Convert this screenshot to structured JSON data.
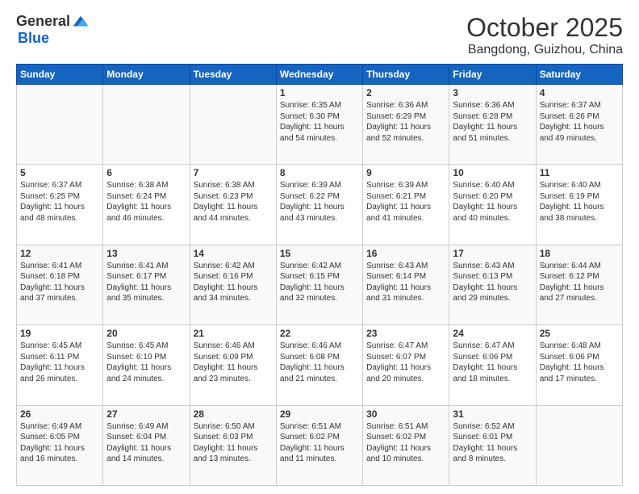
{
  "header": {
    "logo_general": "General",
    "logo_blue": "Blue",
    "month_title": "October 2025",
    "location": "Bangdong, Guizhou, China"
  },
  "weekdays": [
    "Sunday",
    "Monday",
    "Tuesday",
    "Wednesday",
    "Thursday",
    "Friday",
    "Saturday"
  ],
  "weeks": [
    [
      {
        "day": "",
        "sunrise": "",
        "sunset": "",
        "daylight": ""
      },
      {
        "day": "",
        "sunrise": "",
        "sunset": "",
        "daylight": ""
      },
      {
        "day": "",
        "sunrise": "",
        "sunset": "",
        "daylight": ""
      },
      {
        "day": "1",
        "sunrise": "Sunrise: 6:35 AM",
        "sunset": "Sunset: 6:30 PM",
        "daylight": "Daylight: 11 hours and 54 minutes."
      },
      {
        "day": "2",
        "sunrise": "Sunrise: 6:36 AM",
        "sunset": "Sunset: 6:29 PM",
        "daylight": "Daylight: 11 hours and 52 minutes."
      },
      {
        "day": "3",
        "sunrise": "Sunrise: 6:36 AM",
        "sunset": "Sunset: 6:28 PM",
        "daylight": "Daylight: 11 hours and 51 minutes."
      },
      {
        "day": "4",
        "sunrise": "Sunrise: 6:37 AM",
        "sunset": "Sunset: 6:26 PM",
        "daylight": "Daylight: 11 hours and 49 minutes."
      }
    ],
    [
      {
        "day": "5",
        "sunrise": "Sunrise: 6:37 AM",
        "sunset": "Sunset: 6:25 PM",
        "daylight": "Daylight: 11 hours and 48 minutes."
      },
      {
        "day": "6",
        "sunrise": "Sunrise: 6:38 AM",
        "sunset": "Sunset: 6:24 PM",
        "daylight": "Daylight: 11 hours and 46 minutes."
      },
      {
        "day": "7",
        "sunrise": "Sunrise: 6:38 AM",
        "sunset": "Sunset: 6:23 PM",
        "daylight": "Daylight: 11 hours and 44 minutes."
      },
      {
        "day": "8",
        "sunrise": "Sunrise: 6:39 AM",
        "sunset": "Sunset: 6:22 PM",
        "daylight": "Daylight: 11 hours and 43 minutes."
      },
      {
        "day": "9",
        "sunrise": "Sunrise: 6:39 AM",
        "sunset": "Sunset: 6:21 PM",
        "daylight": "Daylight: 11 hours and 41 minutes."
      },
      {
        "day": "10",
        "sunrise": "Sunrise: 6:40 AM",
        "sunset": "Sunset: 6:20 PM",
        "daylight": "Daylight: 11 hours and 40 minutes."
      },
      {
        "day": "11",
        "sunrise": "Sunrise: 6:40 AM",
        "sunset": "Sunset: 6:19 PM",
        "daylight": "Daylight: 11 hours and 38 minutes."
      }
    ],
    [
      {
        "day": "12",
        "sunrise": "Sunrise: 6:41 AM",
        "sunset": "Sunset: 6:18 PM",
        "daylight": "Daylight: 11 hours and 37 minutes."
      },
      {
        "day": "13",
        "sunrise": "Sunrise: 6:41 AM",
        "sunset": "Sunset: 6:17 PM",
        "daylight": "Daylight: 11 hours and 35 minutes."
      },
      {
        "day": "14",
        "sunrise": "Sunrise: 6:42 AM",
        "sunset": "Sunset: 6:16 PM",
        "daylight": "Daylight: 11 hours and 34 minutes."
      },
      {
        "day": "15",
        "sunrise": "Sunrise: 6:42 AM",
        "sunset": "Sunset: 6:15 PM",
        "daylight": "Daylight: 11 hours and 32 minutes."
      },
      {
        "day": "16",
        "sunrise": "Sunrise: 6:43 AM",
        "sunset": "Sunset: 6:14 PM",
        "daylight": "Daylight: 11 hours and 31 minutes."
      },
      {
        "day": "17",
        "sunrise": "Sunrise: 6:43 AM",
        "sunset": "Sunset: 6:13 PM",
        "daylight": "Daylight: 11 hours and 29 minutes."
      },
      {
        "day": "18",
        "sunrise": "Sunrise: 6:44 AM",
        "sunset": "Sunset: 6:12 PM",
        "daylight": "Daylight: 11 hours and 27 minutes."
      }
    ],
    [
      {
        "day": "19",
        "sunrise": "Sunrise: 6:45 AM",
        "sunset": "Sunset: 6:11 PM",
        "daylight": "Daylight: 11 hours and 26 minutes."
      },
      {
        "day": "20",
        "sunrise": "Sunrise: 6:45 AM",
        "sunset": "Sunset: 6:10 PM",
        "daylight": "Daylight: 11 hours and 24 minutes."
      },
      {
        "day": "21",
        "sunrise": "Sunrise: 6:46 AM",
        "sunset": "Sunset: 6:09 PM",
        "daylight": "Daylight: 11 hours and 23 minutes."
      },
      {
        "day": "22",
        "sunrise": "Sunrise: 6:46 AM",
        "sunset": "Sunset: 6:08 PM",
        "daylight": "Daylight: 11 hours and 21 minutes."
      },
      {
        "day": "23",
        "sunrise": "Sunrise: 6:47 AM",
        "sunset": "Sunset: 6:07 PM",
        "daylight": "Daylight: 11 hours and 20 minutes."
      },
      {
        "day": "24",
        "sunrise": "Sunrise: 6:47 AM",
        "sunset": "Sunset: 6:06 PM",
        "daylight": "Daylight: 11 hours and 18 minutes."
      },
      {
        "day": "25",
        "sunrise": "Sunrise: 6:48 AM",
        "sunset": "Sunset: 6:06 PM",
        "daylight": "Daylight: 11 hours and 17 minutes."
      }
    ],
    [
      {
        "day": "26",
        "sunrise": "Sunrise: 6:49 AM",
        "sunset": "Sunset: 6:05 PM",
        "daylight": "Daylight: 11 hours and 16 minutes."
      },
      {
        "day": "27",
        "sunrise": "Sunrise: 6:49 AM",
        "sunset": "Sunset: 6:04 PM",
        "daylight": "Daylight: 11 hours and 14 minutes."
      },
      {
        "day": "28",
        "sunrise": "Sunrise: 6:50 AM",
        "sunset": "Sunset: 6:03 PM",
        "daylight": "Daylight: 11 hours and 13 minutes."
      },
      {
        "day": "29",
        "sunrise": "Sunrise: 6:51 AM",
        "sunset": "Sunset: 6:02 PM",
        "daylight": "Daylight: 11 hours and 11 minutes."
      },
      {
        "day": "30",
        "sunrise": "Sunrise: 6:51 AM",
        "sunset": "Sunset: 6:02 PM",
        "daylight": "Daylight: 11 hours and 10 minutes."
      },
      {
        "day": "31",
        "sunrise": "Sunrise: 6:52 AM",
        "sunset": "Sunset: 6:01 PM",
        "daylight": "Daylight: 11 hours and 8 minutes."
      },
      {
        "day": "",
        "sunrise": "",
        "sunset": "",
        "daylight": ""
      }
    ]
  ]
}
